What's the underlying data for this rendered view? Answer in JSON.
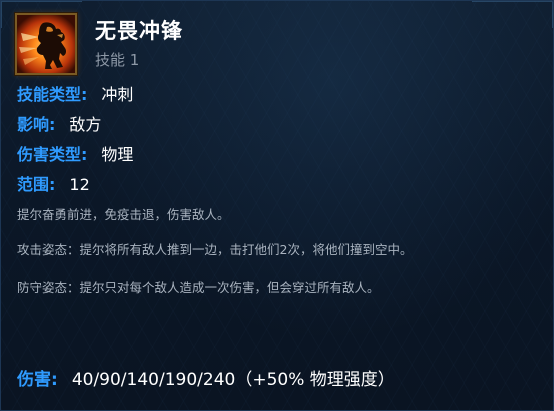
{
  "skill": {
    "icon": "charging-warrior-icon",
    "name": "无畏冲锋",
    "slot": "技能 1"
  },
  "stats": {
    "skill_type": {
      "label": "技能类型:",
      "value": "冲刺"
    },
    "affects": {
      "label": "影响:",
      "value": "敌方"
    },
    "damage_type": {
      "label": "伤害类型:",
      "value": "物理"
    },
    "range": {
      "label": "范围:",
      "value": "12"
    }
  },
  "description": {
    "summary": "提尔奋勇前进，免疫击退，伤害敌人。",
    "attack_stance": "攻击姿态：提尔将所有敌人推到一边，击打他们2次，将他们撞到空中。",
    "defense_stance": "防守姿态：提尔只对每个敌人造成一次伤害，但会穿过所有敌人。"
  },
  "damage": {
    "label": "伤害:",
    "value": "40/90/140/190/240（+50% 物理强度）"
  },
  "colors": {
    "label_blue": "#2f9bff",
    "value_white": "#ffffff",
    "desc_gray": "#a9b3bf",
    "background": "#0b1727",
    "icon_border": "#7a5a23"
  }
}
